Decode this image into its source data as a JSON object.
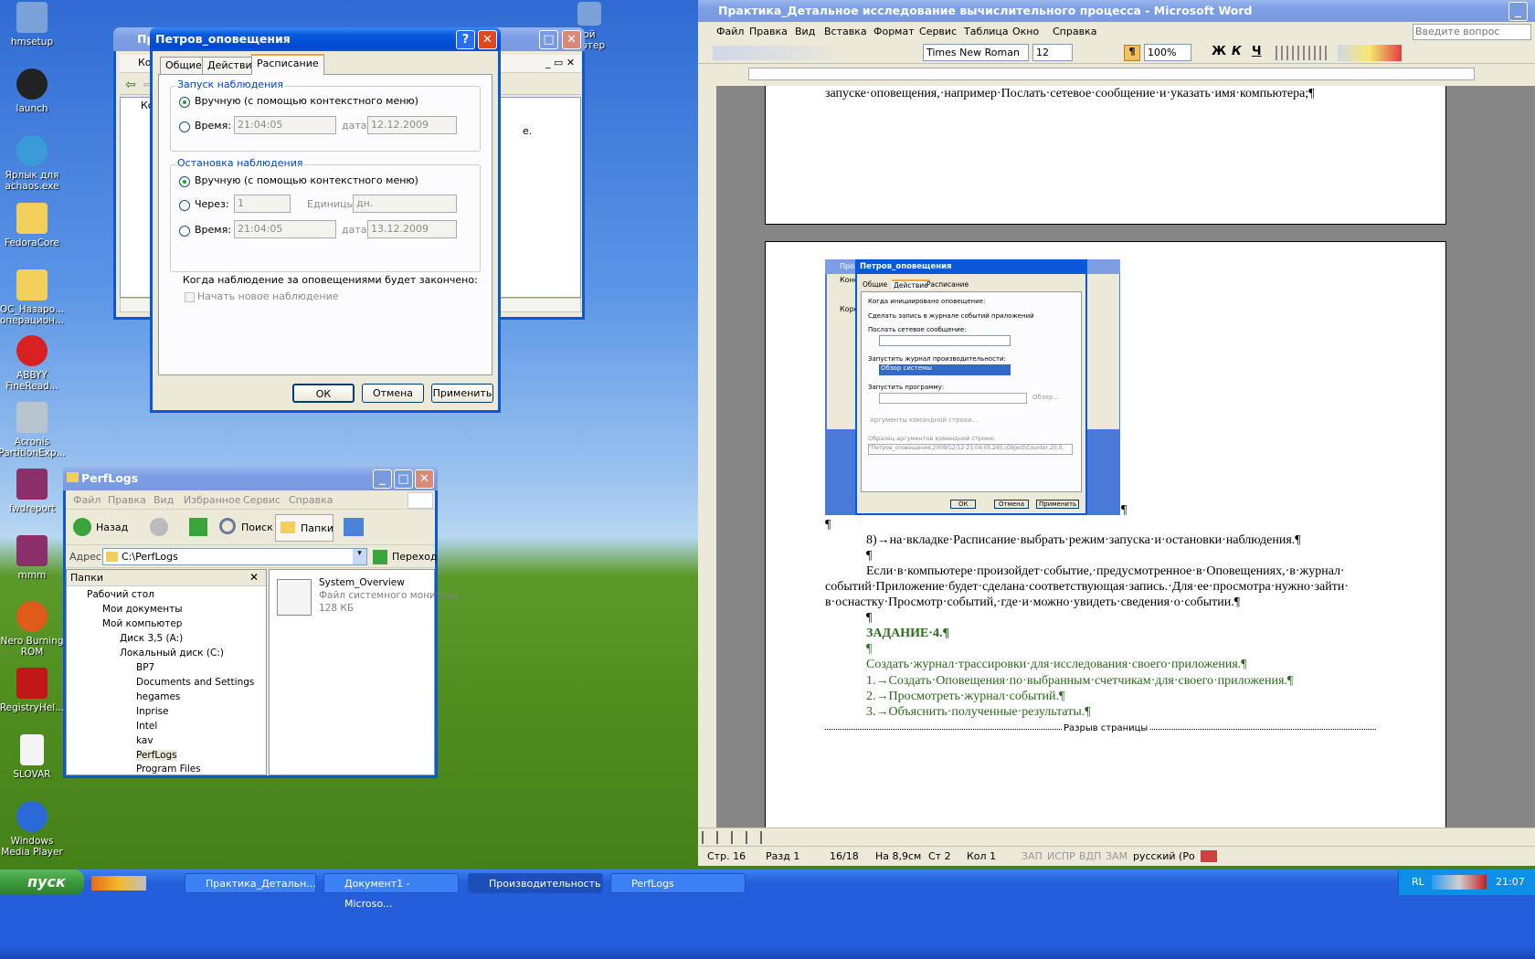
{
  "desktop": {
    "icons": [
      "hmsetup",
      "launch",
      "Ярлык для achaos.exe",
      "FedoraCore",
      "OC_Назаро... операцион...",
      "ABBYY FineRead...",
      "Acronis PartitionExp...",
      "fwdreport",
      "mmm",
      "Nero Burning ROM",
      "RegistryHel...",
      "SLOVAR",
      "Windows Media Player"
    ],
    "partial_icon": "ой ьютер"
  },
  "perf_window": {
    "title": "Про",
    "row1": "Конс",
    "tree1": "Корен",
    "text_right": "е."
  },
  "dialog": {
    "title": "Петров_оповещения",
    "tabs": [
      "Общие",
      "Действие",
      "Расписание"
    ],
    "start_group": "Запуск наблюдения",
    "start_manual": "Вручную (с помощью контекстного меню)",
    "start_time_label": "Время:",
    "start_time": "21:04:05",
    "start_date_label": "дата",
    "start_date": "12.12.2009",
    "stop_group": "Остановка наблюдения",
    "stop_manual": "Вручную (с помощью контекстного меню)",
    "stop_after_label": "Через:",
    "stop_after_val": "1",
    "units_label": "Единицы:",
    "units_val": "дн.",
    "stop_time_label": "Время:",
    "stop_time": "21:04:05",
    "stop_date_label": "дата",
    "stop_date": "13.12.2009",
    "when_done": "Когда наблюдение за оповещениями будет закончено:",
    "new_obs": "Начать новое наблюдение",
    "ok": "ОК",
    "cancel": "Отмена",
    "apply": "Применить"
  },
  "explorer": {
    "title": "PerfLogs",
    "menu": [
      "Файл",
      "Правка",
      "Вид",
      "Избранное",
      "Сервис",
      "Справка"
    ],
    "back": "Назад",
    "search": "Поиск",
    "folders": "Папки",
    "address_label": "Адрес:",
    "address": "C:\\PerfLogs",
    "go": "Переход",
    "pane_title": "Папки",
    "tree": [
      "Рабочий стол",
      "Мои документы",
      "Мой компьютер",
      "Диск 3,5 (A:)",
      "Локальный диск (C:)",
      "BP7",
      "Documents and Settings",
      "hegames",
      "Inprise",
      "Intel",
      "kav",
      "PerfLogs",
      "Program Files"
    ],
    "file_name": "System_Overview",
    "file_type": "Файл системного монитора",
    "file_size": "128 КБ"
  },
  "word": {
    "title": "Практика_Детальное исследование вычислительного процесса - Microsoft Word",
    "menu": [
      "Файл",
      "Правка",
      "Вид",
      "Вставка",
      "Формат",
      "Сервис",
      "Таблица",
      "Окно",
      "Справка"
    ],
    "ask": "Введите вопрос",
    "font": "Times New Roman",
    "size": "12",
    "zoom": "100%",
    "lines": {
      "l0": "запуске·оповещения,·например·Послать·сетевое·сообщение·и·указать·имя·компьютера;¶",
      "l1": "¶",
      "l2": "8)→на·вкладке·Расписание·выбрать·режим·запуска·и·остановки·наблюдения.¶",
      "l3": "¶",
      "l4": "Если·в·компьютере·произойдет·событие,·предусмотренное·в·Оповещениях,·в·журнал·",
      "l5": "событий·Приложение·будет·сделана·соответствующая·запись.·Для·ее·просмотра·нужно·зайти·",
      "l6": "в·оснастку·Просмотр·событий,·где·и·можно·увидеть·сведения·о·событии.¶",
      "l7": "¶",
      "l8": "ЗАДАНИЕ·4.¶",
      "l9": "¶",
      "l10": "Создать·журнал·трассировки·для·исследования·своего·приложения.¶",
      "l11": "1.→Создать·Оповещения·по·выбранным·счетчикам·для·своего·приложения.¶",
      "l12": "2.→Просмотреть·журнал·событий.¶",
      "l13": "3.→Объяснить·полученные·результаты.¶",
      "pilcrow": "¶",
      "pagebreak": "Разрыв страницы"
    },
    "embedded": {
      "title": "Петров_оповещения",
      "tabs": [
        "Общие",
        "Действие",
        "Расписание"
      ],
      "label": "Когда инициировано оповещение:",
      "c1": "Сделать запись в журнале событий приложений",
      "c2": "Послать сетевое сообщение:",
      "c3": "Запустить журнал производительности:",
      "c3val": "Обзор системы",
      "c4": "Запустить программу:",
      "browse": "Обзор...",
      "args_btn": "Аргументы командной строки...",
      "sample_label": "Образец аргументов командной строки:",
      "sample": "\"Петров_оповещения,2009/12/12-21:04:05.265,\\Object\\Counter,20.0,",
      "ok": "ОК",
      "cancel": "Отмена",
      "apply": "Применить",
      "bg_title": "Про",
      "bg_row": "Конс",
      "bg_tree": "Корен"
    },
    "status": {
      "page": "Стр.  16",
      "section": "Разд  1",
      "pages": "16/18",
      "at": "На  8,9см",
      "line": "Ст  2",
      "col": "Кол  1",
      "rec": "ЗАП",
      "trk": "ИСПР",
      "ext": "ВДП",
      "ovr": "ЗАМ",
      "lang": "русский (Ро"
    }
  },
  "taskbar": {
    "start": "пуск",
    "buttons": [
      "Практика_Детальн...",
      "Документ1 - Microso...",
      "Производительность",
      "PerfLogs"
    ],
    "lang": "RL",
    "time": "21:07"
  },
  "colors": {
    "taskbar": "#245edb",
    "start": "#3a9b3a",
    "title_active": "#0a5ae0"
  }
}
